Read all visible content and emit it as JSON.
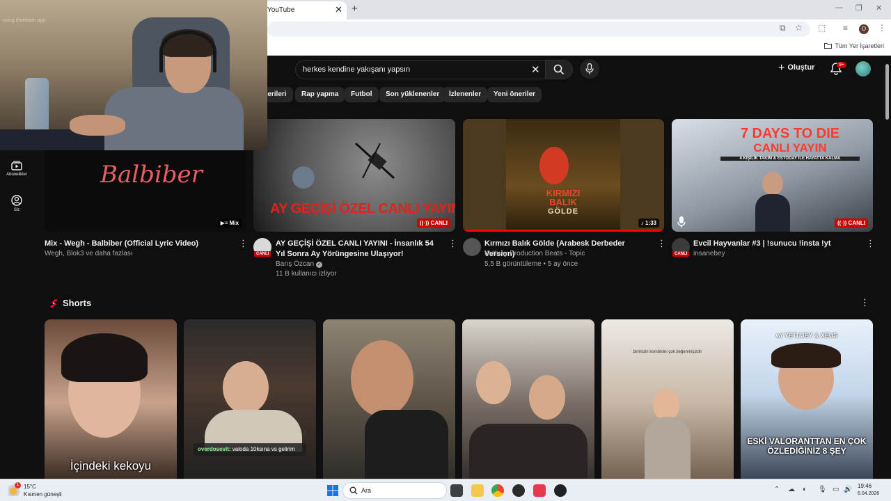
{
  "browser": {
    "tab_title": "YouTube",
    "tab_close": "✕",
    "new_tab": "+",
    "bookmarks_all": "Tüm Yer İşaretleri"
  },
  "webcam": {
    "label": "using droidcam app"
  },
  "youtube": {
    "search_query": "herkes kendine yakışanı yapsın",
    "create_label": "Oluştur",
    "notif_count": "9+",
    "chips": [
      "terileri",
      "Rap yapma",
      "Futbol",
      "Son yüklenenler",
      "İzlenenler",
      "Yeni öneriler"
    ],
    "sidebar": [
      {
        "label": "Abonelikler",
        "icon": "subscriptions-icon"
      },
      {
        "label": "Siz",
        "icon": "you-icon"
      }
    ],
    "videos": [
      {
        "thumb_text": "Balbiber",
        "badge": "Mix",
        "title": "Mix - Wegh - Balbiber (Official Lyric Video)",
        "channel": "Wegh, Blok3 ve daha fazlası",
        "meta": ""
      },
      {
        "thumb_text": "AY GEÇİŞİ ÖZEL CANLI YAYINI",
        "badge": "CANLI",
        "title": "AY GEÇİŞİ ÖZEL CANLI YAYINI - İnsanlık 54 Yıl Sonra Ay Yörüngesine Ulaşıyor!",
        "channel": "Barış Özcan",
        "meta": "11 B kullanıcı izliyor",
        "avatar_live": "CANLI"
      },
      {
        "thumb_text_1": "KIRMIZI",
        "thumb_text_2": "BALIK",
        "thumb_text_3": "GÖLDE",
        "badge": "1:33",
        "title": "Kırmızı Balık Gölde (Arabesk Derbeder Version)",
        "channel": "Kutluay Production Beats - Topic",
        "meta": "5,5 B görüntüleme • 5 ay önce"
      },
      {
        "thumb_text_1": "7 DAYS TO DIE",
        "thumb_text_2": "CANLI YAYIN",
        "thumb_text_3": "4 KİŞİLİK TAKIM & ESTODAY İLE HAYATTA KALMA",
        "badge": "CANLI",
        "title": "Evcil Hayvanlar #3 | !sunucu !insta !yt",
        "channel": "insanebey",
        "meta": "",
        "avatar_live": "CANLI"
      }
    ],
    "shorts_title": "Shorts",
    "shorts": [
      {
        "caption": "İçindeki kekoyu"
      },
      {
        "caption_user": "overdosevit:",
        "caption_text": " valoda 10ksına vs gelirim"
      },
      {
        "caption": ""
      },
      {
        "caption": ""
      },
      {
        "caption": "birimizin kombinini çok beğenmişizdir"
      },
      {
        "top": "w/ YETUJEY & XEUS",
        "caption": "ESKİ VALORANTTAN EN ÇOK ÖZLEDİĞİNİZ 8 ŞEY"
      }
    ]
  },
  "taskbar": {
    "notif_badge": "1",
    "weather_temp": "15°C",
    "weather_desc": "Kısmen güneşli",
    "search_label": "Ara",
    "time": "19:46",
    "date": "6.04.2026"
  }
}
